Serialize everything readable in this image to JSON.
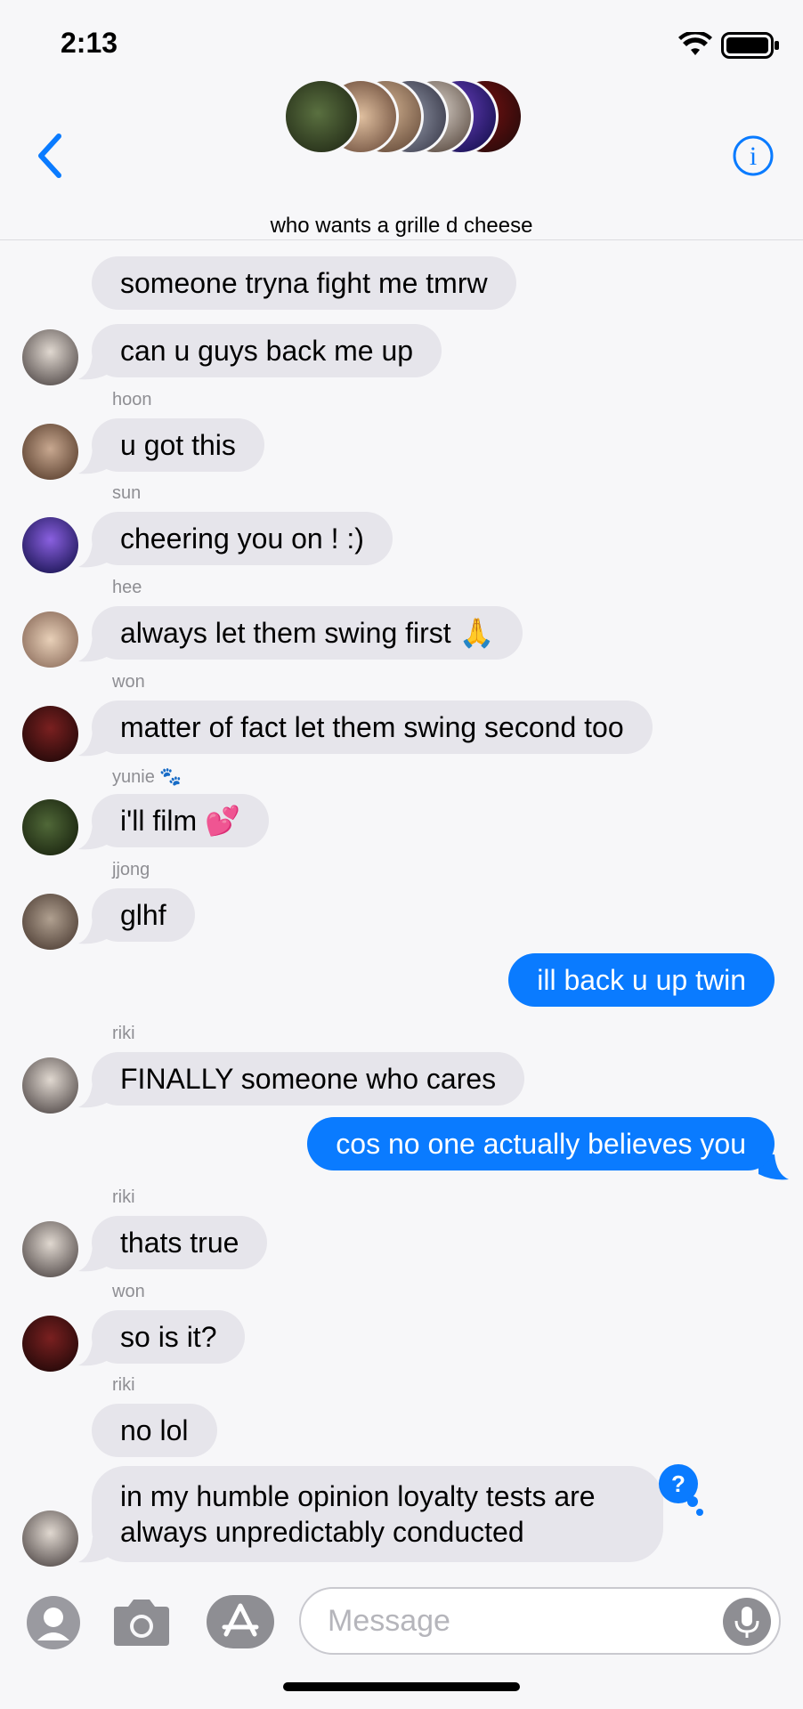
{
  "status_bar": {
    "time": "2:13"
  },
  "header": {
    "title": "who wants a grille d cheese",
    "back_icon": "chevron-left-icon",
    "info_icon": "info-icon",
    "accent_color": "#0a7bff"
  },
  "messages": [
    {
      "direction": "in",
      "sender": "",
      "text": "someone tryna fight me tmrw",
      "show_avatar": false
    },
    {
      "direction": "in",
      "sender": "",
      "text": "can u guys back me up",
      "show_avatar": true
    },
    {
      "direction": "in",
      "sender": "hoon",
      "text": "u got this",
      "show_avatar": true
    },
    {
      "direction": "in",
      "sender": "sun",
      "text": "cheering you on ! :)",
      "show_avatar": true
    },
    {
      "direction": "in",
      "sender": "hee",
      "text": "always let them swing first 🙏",
      "show_avatar": true
    },
    {
      "direction": "in",
      "sender": "won",
      "text": "matter of fact let them swing second too",
      "show_avatar": true
    },
    {
      "direction": "in",
      "sender": "yunie 🐾",
      "text": "i'll film 💕",
      "show_avatar": true
    },
    {
      "direction": "in",
      "sender": "jjong",
      "text": "glhf",
      "show_avatar": true
    },
    {
      "direction": "out",
      "sender": "",
      "text": "ill back u up twin",
      "show_avatar": false
    },
    {
      "direction": "in",
      "sender": "riki",
      "text": "FINALLY someone who cares",
      "show_avatar": true
    },
    {
      "direction": "out",
      "sender": "",
      "text": "cos no one actually believes you",
      "show_avatar": false
    },
    {
      "direction": "in",
      "sender": "riki",
      "text": "thats true",
      "show_avatar": true
    },
    {
      "direction": "in",
      "sender": "won",
      "text": "so is it?",
      "show_avatar": true
    },
    {
      "direction": "in",
      "sender": "riki",
      "text": "no lol",
      "show_avatar": false
    },
    {
      "direction": "in",
      "sender": "",
      "text": "in my humble opinion loyalty tests are always unpredictably conducted",
      "show_avatar": true
    }
  ],
  "input": {
    "placeholder": "Message",
    "value": ""
  },
  "colors": {
    "incoming_bubble": "#e6e5eb",
    "outgoing_bubble": "#0a7bff",
    "sender_label": "#8e8e93",
    "background": "#f7f7f9"
  }
}
